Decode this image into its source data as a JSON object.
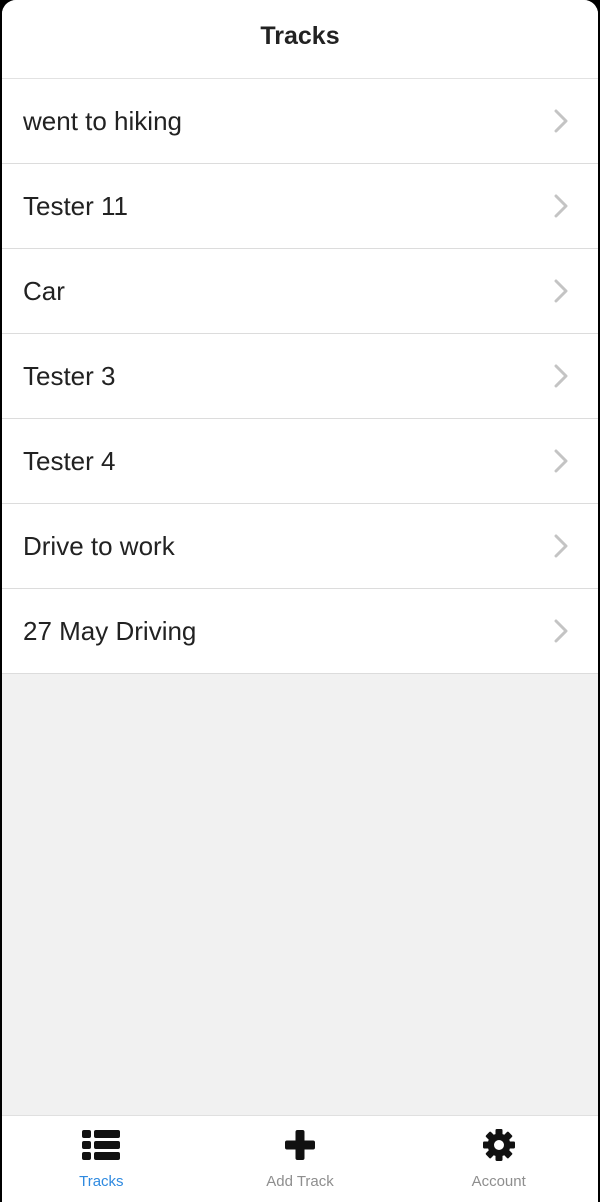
{
  "header": {
    "title": "Tracks"
  },
  "tracks": [
    {
      "label": "went to hiking"
    },
    {
      "label": "Tester 11"
    },
    {
      "label": "Car"
    },
    {
      "label": "Tester 3"
    },
    {
      "label": "Tester 4"
    },
    {
      "label": "Drive to work"
    },
    {
      "label": "27 May Driving"
    }
  ],
  "tabbar": {
    "tabs": [
      {
        "label": "Tracks",
        "icon": "list-icon",
        "active": true
      },
      {
        "label": "Add Track",
        "icon": "plus-icon",
        "active": false
      },
      {
        "label": "Account",
        "icon": "gear-icon",
        "active": false
      }
    ]
  },
  "colors": {
    "accent": "#2f8ae0",
    "inactive": "#8e8e8e",
    "background": "#f1f1f1",
    "text": "#222222"
  }
}
